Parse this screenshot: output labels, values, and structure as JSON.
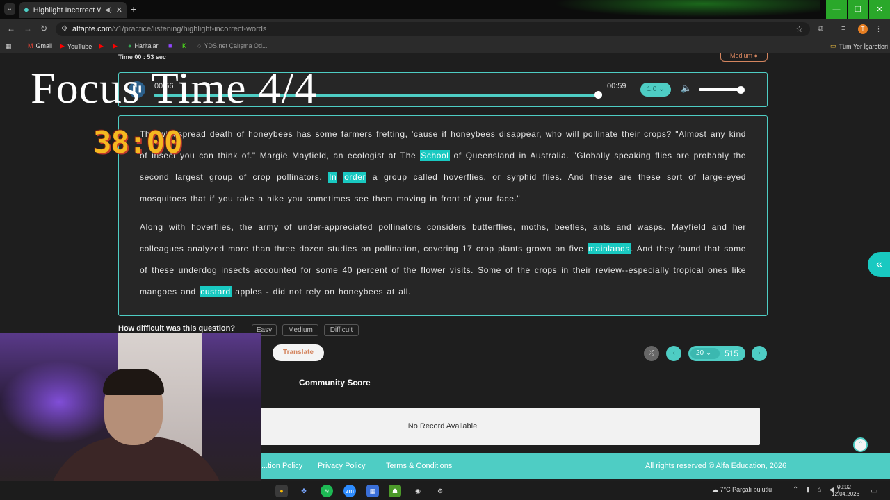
{
  "browser": {
    "tab_title": "Highlight Incorrect Words",
    "tab_close": "✕",
    "new_tab": "+",
    "url_host": "alfapte.com",
    "url_path": "/v1/practice/listening/highlight-incorrect-words",
    "profile_initial": "T",
    "bookmarks": [
      {
        "label": "Gmail"
      },
      {
        "label": "YouTube"
      },
      {
        "label": "Haritalar"
      },
      {
        "label": "YDS.net Çalışma Od..."
      }
    ],
    "all_bookmarks": "Tüm Yer İşaretleri"
  },
  "page": {
    "time_label": "Time 00 : 53 sec",
    "difficulty_badge": "Medium",
    "player": {
      "current_time": "00:56",
      "end_time": "00:59",
      "speed": "1.0",
      "progress": 0.99,
      "volume": 1.0
    },
    "passage": {
      "p1": [
        {
          "t": "The widespread death of honeybees has some farmers fretting, 'cause if honeybees disappear, who will pollinate their crops? \"Almost any kind of insect you can think of.\" Margie Mayfield, an ecologist at The "
        },
        {
          "t": "School",
          "hl": true
        },
        {
          "t": " of Queensland in Australia. \"Globally speaking flies are probably the second largest group of crop pollinators. "
        },
        {
          "t": "In",
          "hl": true
        },
        {
          "t": " "
        },
        {
          "t": "order",
          "hl": true
        },
        {
          "t": " a group called hoverflies, or syrphid flies. And these are these sort of large-eyed mosquitoes that if you take a hike you sometimes see them moving in front of your face.\""
        }
      ],
      "p2": [
        {
          "t": "Along with hoverflies, the army of under-appreciated pollinators considers butterflies, moths, beetles, ants and wasps. Mayfield and her colleagues analyzed more than three dozen studies on pollination, covering 17 crop plants grown on five "
        },
        {
          "t": "mainlands",
          "hl": true
        },
        {
          "t": ". And they found that some of these underdog insects accounted for some 40 percent of the flower visits. Some of the crops in their review--especially tropical ones like mangoes and "
        },
        {
          "t": "custard",
          "hl": true
        },
        {
          "t": " apples - did not rely on honeybees at all."
        }
      ]
    },
    "question_label": "How difficult was this question?",
    "difficulty_options": [
      "Easy",
      "Medium",
      "Difficult"
    ],
    "translate_label": "Translate",
    "pager": {
      "current": "20",
      "total": "515"
    },
    "community_title": "Community Score",
    "no_record": "No Record Available",
    "footer": {
      "cancellation": "...tion Policy",
      "privacy": "Privacy Policy",
      "terms": "Terms & Conditions",
      "copyright": "All rights reserved © Alfa Education, 2026"
    }
  },
  "overlay": {
    "focus_title": "Focus Time 4/4",
    "timer": "38:00"
  },
  "taskbar": {
    "weather": "7°C  Parçalı bulutlu",
    "time": "00:02",
    "date": "12.04.2026"
  }
}
